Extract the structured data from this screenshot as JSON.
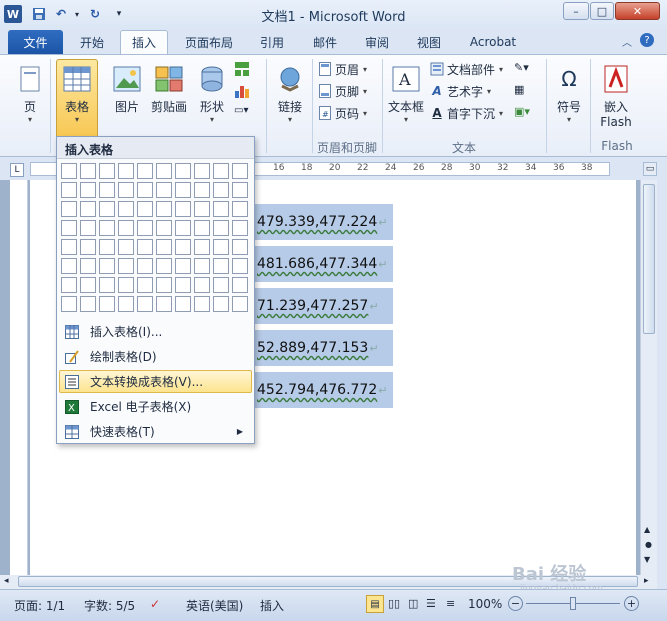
{
  "window": {
    "title": "文档1 - Microsoft Word",
    "min": "–",
    "max": "□",
    "close": "✕"
  },
  "tabs": [
    "文件",
    "开始",
    "插入",
    "页面布局",
    "引用",
    "邮件",
    "审阅",
    "视图",
    "Acrobat"
  ],
  "ribbon": {
    "page_btn": "页",
    "table_btn": "表格",
    "picture_btn": "图片",
    "clipart_btn": "剪贴画",
    "shapes_btn": "形状",
    "link_btn": "链接",
    "header_btn": "页眉",
    "footer_btn": "页脚",
    "pagenum_btn": "页码",
    "header_group": "页眉和页脚",
    "textbox_btn": "文本框",
    "docparts_btn": "文档部件",
    "wordart_btn": "艺术字",
    "dropcap_btn": "首字下沉",
    "text_group": "文本",
    "symbol_btn": "符号",
    "flash_btn_line1": "嵌入",
    "flash_btn_line2": "Flash",
    "flash_group": "Flash",
    "symbol_glyph": "Ω"
  },
  "ruler_ticks": [
    "16",
    "18",
    "20",
    "22",
    "24",
    "26",
    "28",
    "30",
    "32",
    "34",
    "36",
    "38"
  ],
  "document": {
    "lines": [
      "479.339,477.224",
      "481.686,477.344",
      "71.239,477.257",
      "52.889,477.153",
      "452.794,476.772"
    ],
    "para_mark": "↵"
  },
  "menu": {
    "title": "插入表格",
    "items": [
      {
        "label": "插入表格(I)...",
        "icon": "table-insert-icon"
      },
      {
        "label": "绘制表格(D)",
        "icon": "draw-table-icon"
      },
      {
        "label": "文本转换成表格(V)...",
        "icon": "text-to-table-icon"
      },
      {
        "label": "Excel 电子表格(X)",
        "icon": "excel-icon"
      },
      {
        "label": "快速表格(T)",
        "icon": "quick-table-icon"
      }
    ]
  },
  "status": {
    "page": "页面: 1/1",
    "words": "字数: 5/5",
    "language": "英语(美国)",
    "mode": "插入",
    "zoom": "100%"
  },
  "watermark": {
    "text": "Bai 经验",
    "sub": "jingyan.baidu.com"
  },
  "colors": {
    "file_tab": "#2a64b8",
    "highlight": "#b6cbe8",
    "menu_hover": "#fde48f"
  }
}
